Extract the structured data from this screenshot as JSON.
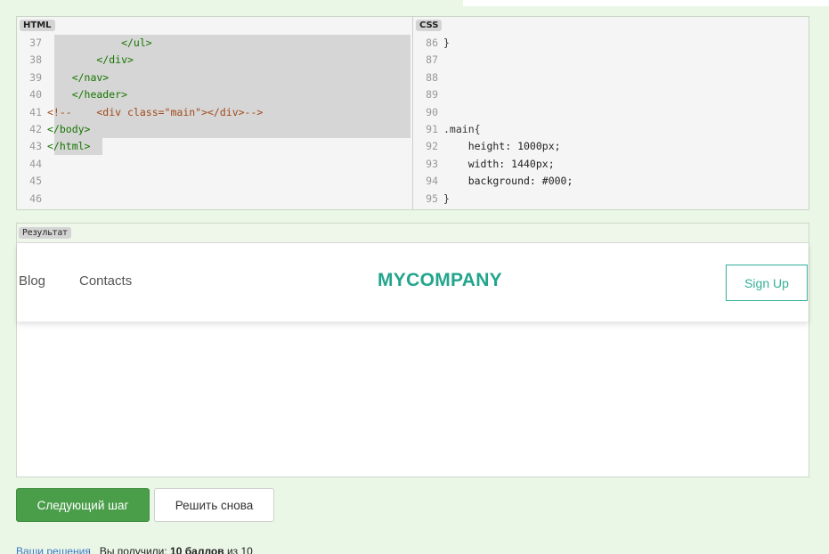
{
  "editors": {
    "html_tab": "HTML",
    "css_tab": "CSS",
    "html_lines": [
      {
        "n": "37",
        "t": "            </ul>"
      },
      {
        "n": "38",
        "t": "        </div>"
      },
      {
        "n": "39",
        "t": "    </nav>"
      },
      {
        "n": "40",
        "t": "    </header>"
      },
      {
        "n": "41",
        "t": "<!--    <div class=\"main\"></div>-->"
      },
      {
        "n": "42",
        "t": "</body>"
      },
      {
        "n": "43",
        "t": "</html>"
      },
      {
        "n": "44",
        "t": ""
      },
      {
        "n": "45",
        "t": ""
      },
      {
        "n": "46",
        "t": ""
      }
    ],
    "css_lines": [
      {
        "n": "86",
        "t": "}"
      },
      {
        "n": "87",
        "t": ""
      },
      {
        "n": "88",
        "t": ""
      },
      {
        "n": "89",
        "t": ""
      },
      {
        "n": "90",
        "t": ""
      },
      {
        "n": "91",
        "t": ".main{"
      },
      {
        "n": "92",
        "t": "    height: 1000px;"
      },
      {
        "n": "93",
        "t": "    width: 1440px;"
      },
      {
        "n": "94",
        "t": "    background: #000;"
      },
      {
        "n": "95",
        "t": "}"
      }
    ]
  },
  "result": {
    "tab": "Результат",
    "nav": {
      "blog": "Blog",
      "contacts": "Contacts"
    },
    "logo": "MYCOMPANY",
    "signup": "Sign Up"
  },
  "actions": {
    "next": "Следующий шаг",
    "again": "Решить снова"
  },
  "footer": {
    "link": "Ваши решения",
    "text_before": "Вы получили: ",
    "score": "10 баллов",
    "text_after": " из 10"
  },
  "colors": {
    "background": "#eaf6e6",
    "brand": "#22a58c",
    "signup_border": "#33b09a",
    "next_button": "#4a9e4a"
  }
}
